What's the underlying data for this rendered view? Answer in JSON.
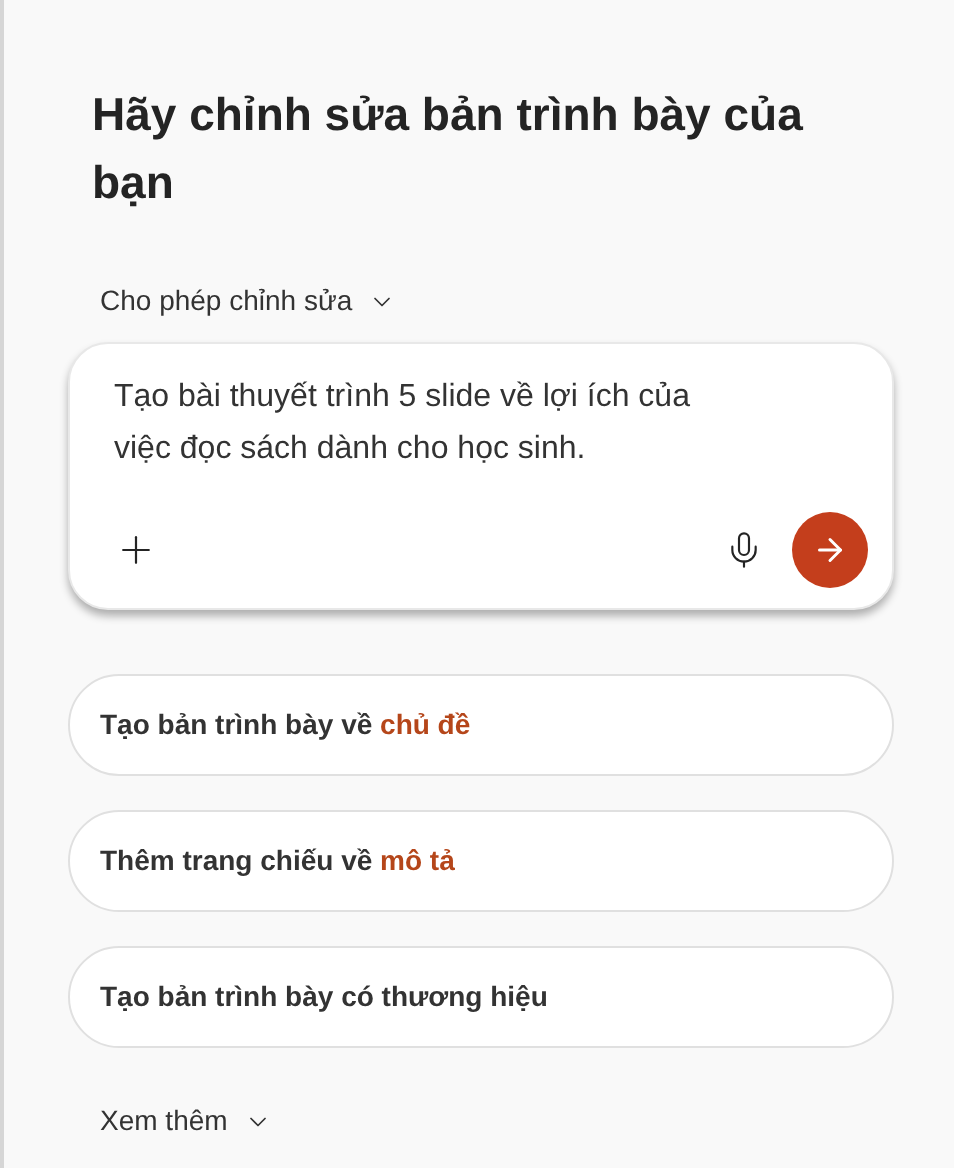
{
  "title": "Hãy chỉnh sửa bản trình bày của bạn",
  "mode_dropdown": {
    "label": "Cho phép chỉnh sửa"
  },
  "prompt": {
    "value": "Tạo bài thuyết trình 5 slide về lợi ích của việc đọc sách dành cho học sinh."
  },
  "suggestions": [
    {
      "parts": [
        {
          "text": "Tạo bản trình bày về ",
          "accent": false
        },
        {
          "text": "chủ đề",
          "accent": true
        }
      ]
    },
    {
      "parts": [
        {
          "text": "Thêm trang chiếu về ",
          "accent": false
        },
        {
          "text": "mô tả",
          "accent": true
        }
      ]
    },
    {
      "parts": [
        {
          "text": "Tạo bản trình bày có thương hiệu",
          "accent": false
        }
      ]
    }
  ],
  "more": {
    "label": "Xem thêm"
  }
}
